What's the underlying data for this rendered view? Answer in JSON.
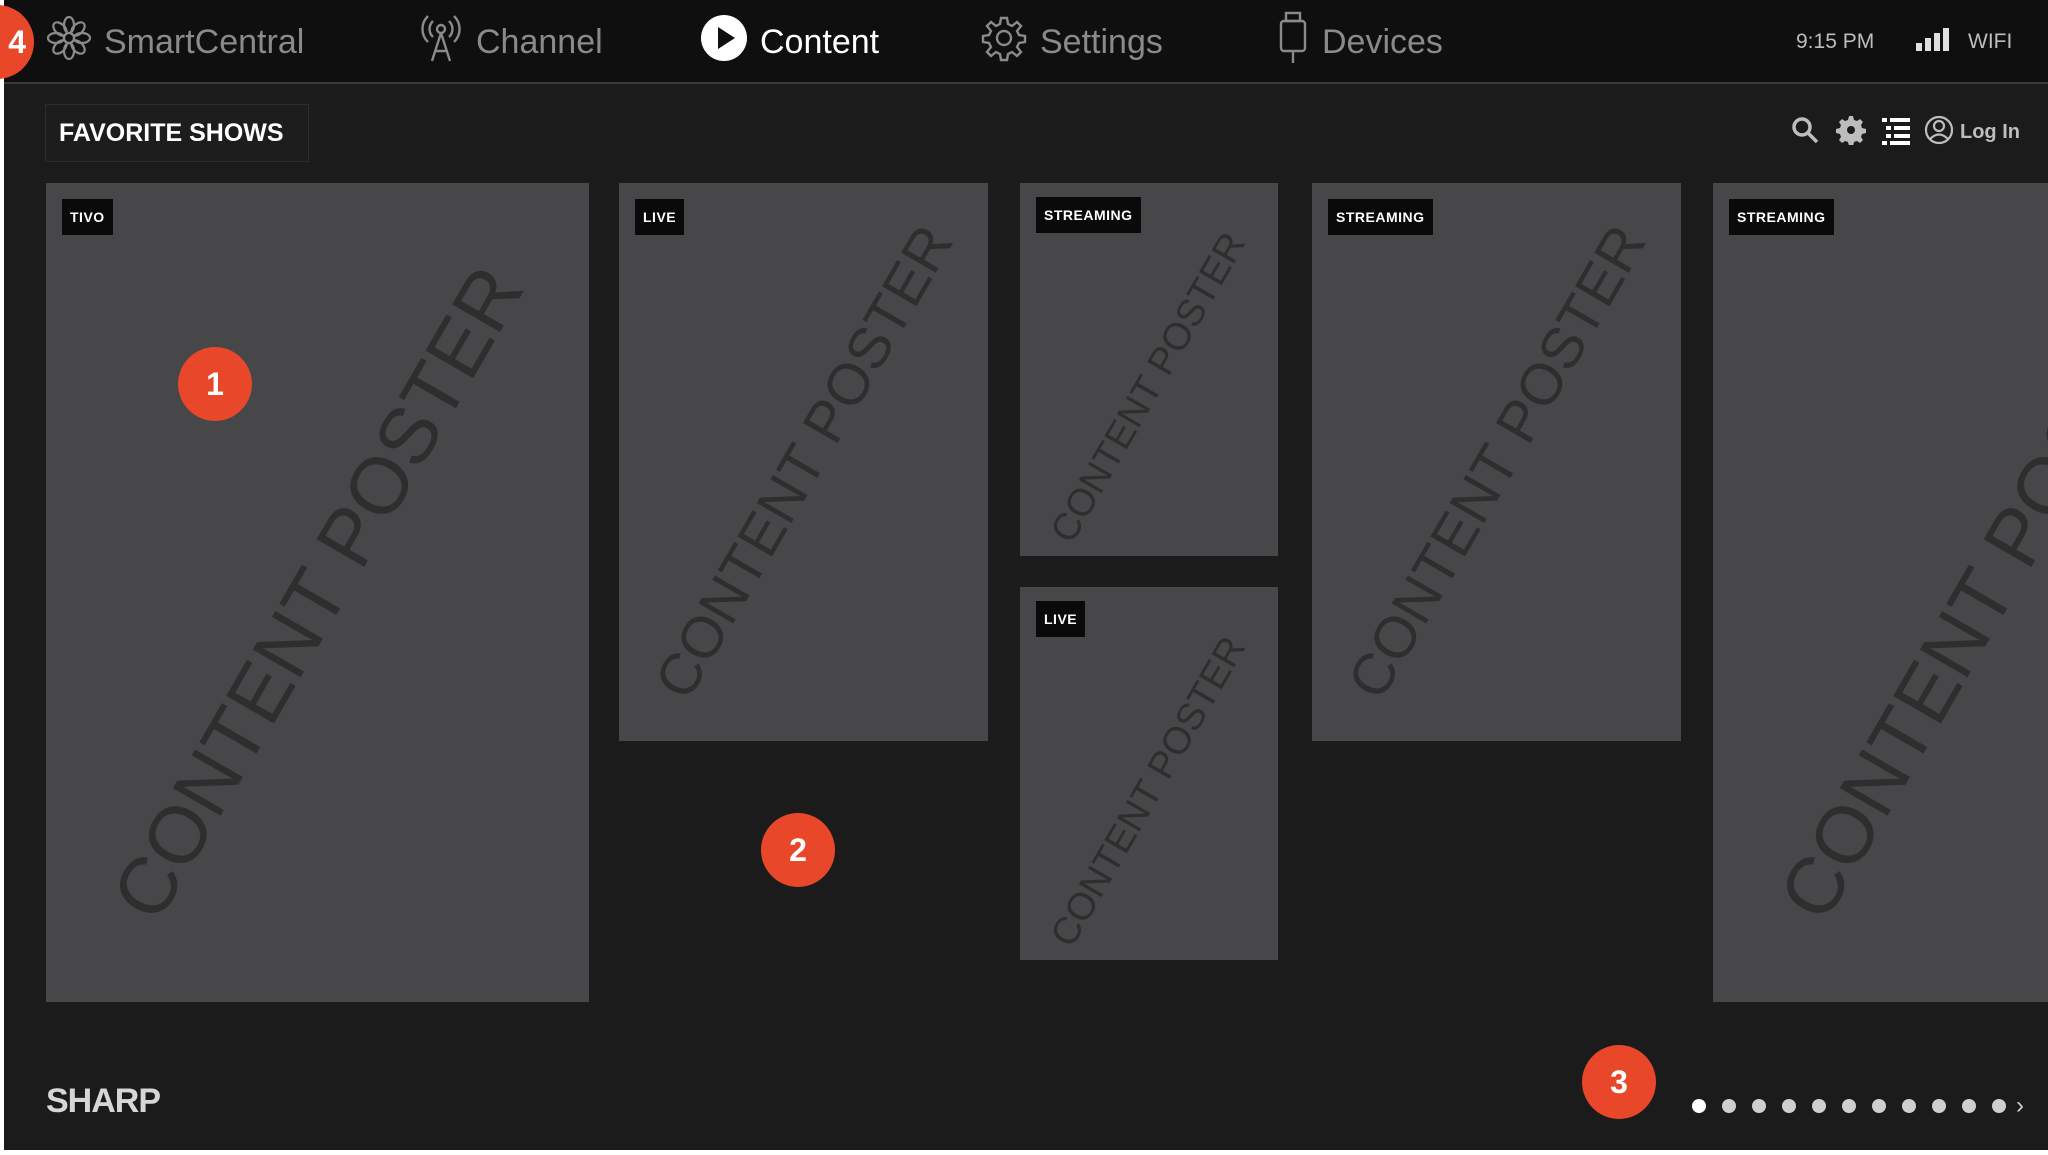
{
  "nav": {
    "items": [
      {
        "label": "SmartCentral",
        "icon": "flower-icon"
      },
      {
        "label": "Channel",
        "icon": "antenna-icon"
      },
      {
        "label": "Content",
        "icon": "play-icon"
      },
      {
        "label": "Settings",
        "icon": "gear-icon"
      },
      {
        "label": "Devices",
        "icon": "usb-device-icon"
      }
    ],
    "active": "Content"
  },
  "status": {
    "time": "9:15 PM",
    "network": "WIFI"
  },
  "section": {
    "title": "FAVORITE SHOWS"
  },
  "toolbar": {
    "login_label": "Log In"
  },
  "cards": [
    {
      "badge": "TIVO",
      "poster": "CONTENT POSTER"
    },
    {
      "badge": "LIVE",
      "poster": "CONTENT POSTER"
    },
    {
      "badge": "STREAMING",
      "poster": "CONTENT POSTER"
    },
    {
      "badge": "LIVE",
      "poster": "CONTENT POSTER"
    },
    {
      "badge": "STREAMING",
      "poster": "CONTENT POSTER"
    },
    {
      "badge": "STREAMING",
      "poster": "CONTENT POSTER"
    }
  ],
  "markers": [
    "1",
    "2",
    "3",
    "4"
  ],
  "pagination": {
    "total": 11,
    "current": 1
  },
  "brand": {
    "logo": "SHARP"
  },
  "colors": {
    "background": "#1b1b1b",
    "card": "#474749",
    "marker": "#e8472a"
  }
}
